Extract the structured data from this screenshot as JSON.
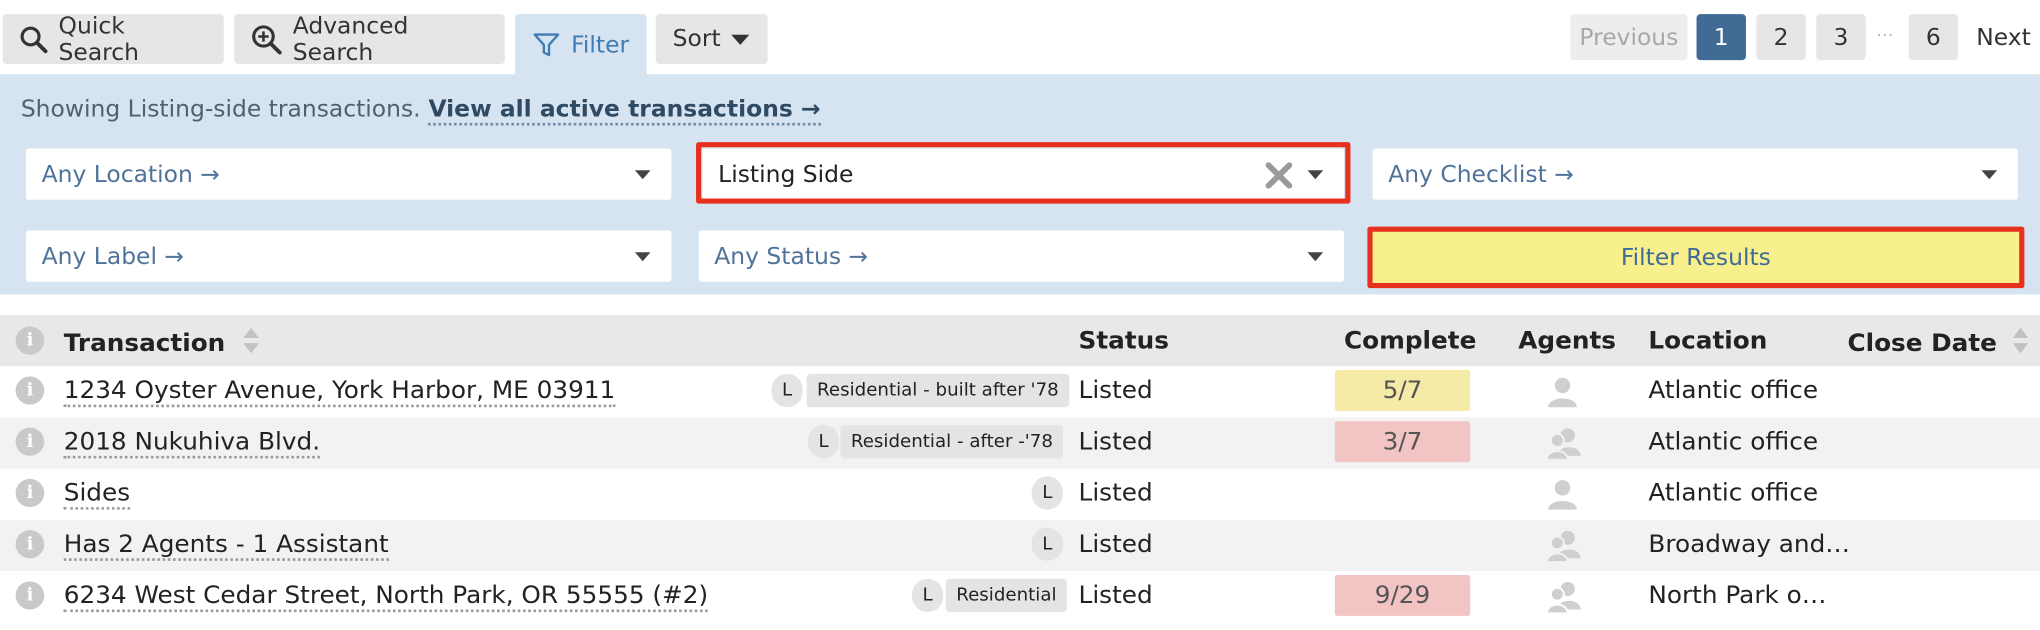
{
  "toolbar": {
    "quick_search": "Quick Search",
    "advanced_search": "Advanced Search",
    "filter": "Filter",
    "sort": "Sort"
  },
  "pagination": {
    "previous": "Previous",
    "pages": [
      "1",
      "2",
      "3",
      "6"
    ],
    "ellipsis": "···",
    "next": "Next",
    "current": "1"
  },
  "filter_panel": {
    "info_text": "Showing Listing-side transactions.",
    "view_all_link": "View all active transactions →",
    "location": "Any Location →",
    "side": "Listing Side",
    "checklist": "Any Checklist →",
    "label": "Any Label →",
    "status": "Any Status →",
    "filter_results": "Filter Results"
  },
  "table": {
    "headers": {
      "transaction": "Transaction",
      "status": "Status",
      "complete": "Complete",
      "agents": "Agents",
      "location": "Location",
      "close_date": "Close Date"
    },
    "rows": [
      {
        "name": "1234 Oyster Avenue, York Harbor, ME 03911",
        "side": "L",
        "tag": "Residential - built after '78",
        "status": "Listed",
        "complete": "5/7",
        "complete_color": "#f6eba6",
        "agents": "single",
        "location": "Atlantic office"
      },
      {
        "name": "2018 Nukuhiva Blvd.",
        "side": "L",
        "tag": "Residential - after -'78",
        "status": "Listed",
        "complete": "3/7",
        "complete_color": "#f2c4c4",
        "agents": "multiple",
        "location": "Atlantic office"
      },
      {
        "name": "Sides",
        "side": "L",
        "tag": "",
        "status": "Listed",
        "complete": "",
        "complete_color": "",
        "agents": "single",
        "location": "Atlantic office"
      },
      {
        "name": "Has 2 Agents - 1 Assistant",
        "side": "L",
        "tag": "",
        "status": "Listed",
        "complete": "",
        "complete_color": "",
        "agents": "multiple",
        "location": "Broadway and…"
      },
      {
        "name": "6234 West Cedar Street, North Park, OR 55555 (#2)",
        "side": "L",
        "tag": "Residential",
        "status": "Listed",
        "complete": "9/29",
        "complete_color": "#f2c4c4",
        "agents": "multiple",
        "location": "North Park o…"
      }
    ]
  },
  "colors": {
    "panel_bg": "#d6e4f1",
    "accent": "#3f6b94",
    "highlight_border": "#e8311d",
    "filter_button_bg": "#f8f08c"
  }
}
